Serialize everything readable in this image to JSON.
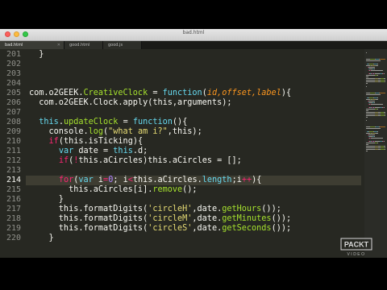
{
  "window": {
    "title": "bad.html"
  },
  "tabs": [
    {
      "label": "bad.html",
      "active": true
    },
    {
      "label": "good.html",
      "active": false
    },
    {
      "label": "good.js",
      "active": false
    }
  ],
  "editor": {
    "current_line": 214,
    "line_numbers": [
      201,
      202,
      203,
      204,
      205,
      206,
      207,
      208,
      209,
      210,
      211,
      212,
      213,
      214,
      215,
      216,
      217,
      218,
      219,
      220
    ],
    "lines": [
      [
        {
          "t": "  }",
          "c": "plain"
        }
      ],
      [],
      [],
      [],
      [
        {
          "t": "com.o2GEEK.",
          "c": "obj"
        },
        {
          "t": "CreativeClock",
          "c": "fn"
        },
        {
          "t": " = ",
          "c": "plain"
        },
        {
          "t": "function",
          "c": "kw"
        },
        {
          "t": "(",
          "c": "plain"
        },
        {
          "t": "id,offset,label",
          "c": "param"
        },
        {
          "t": "){",
          "c": "plain"
        }
      ],
      [
        {
          "t": "  com.o2GEEK.Clock.apply(this,arguments);",
          "c": "plain"
        }
      ],
      [],
      [
        {
          "t": "  ",
          "c": "plain"
        },
        {
          "t": "this",
          "c": "kw"
        },
        {
          "t": ".",
          "c": "plain"
        },
        {
          "t": "updateClock",
          "c": "fn"
        },
        {
          "t": " = ",
          "c": "plain"
        },
        {
          "t": "function",
          "c": "kw"
        },
        {
          "t": "(){",
          "c": "plain"
        }
      ],
      [
        {
          "t": "    console.",
          "c": "plain"
        },
        {
          "t": "log",
          "c": "fn"
        },
        {
          "t": "(",
          "c": "plain"
        },
        {
          "t": "\"what am i?\"",
          "c": "str"
        },
        {
          "t": ",this);",
          "c": "plain"
        }
      ],
      [
        {
          "t": "    ",
          "c": "plain"
        },
        {
          "t": "if",
          "c": "op"
        },
        {
          "t": "(this.isTicking){",
          "c": "plain"
        }
      ],
      [
        {
          "t": "      ",
          "c": "plain"
        },
        {
          "t": "var",
          "c": "kw"
        },
        {
          "t": " date = ",
          "c": "plain"
        },
        {
          "t": "this",
          "c": "kw"
        },
        {
          "t": ".d;",
          "c": "plain"
        }
      ],
      [
        {
          "t": "      ",
          "c": "plain"
        },
        {
          "t": "if",
          "c": "op"
        },
        {
          "t": "(",
          "c": "plain"
        },
        {
          "t": "!",
          "c": "op"
        },
        {
          "t": "this.aCircles)this.aCircles = [];",
          "c": "plain"
        }
      ],
      [],
      [
        {
          "t": "      ",
          "c": "plain"
        },
        {
          "t": "for",
          "c": "op"
        },
        {
          "t": "(",
          "c": "plain"
        },
        {
          "t": "var",
          "c": "kw"
        },
        {
          "t": " i",
          "c": "plain"
        },
        {
          "t": "=",
          "c": "op"
        },
        {
          "t": "0",
          "c": "num"
        },
        {
          "t": "; i",
          "c": "plain"
        },
        {
          "t": "<",
          "c": "op"
        },
        {
          "t": "this.aCircles.",
          "c": "plain"
        },
        {
          "t": "length",
          "c": "kw"
        },
        {
          "t": ";i",
          "c": "plain"
        },
        {
          "t": "++",
          "c": "op"
        },
        {
          "t": "){",
          "c": "plain"
        }
      ],
      [
        {
          "t": "        this.aCircles[i].",
          "c": "plain"
        },
        {
          "t": "remove",
          "c": "fn"
        },
        {
          "t": "();",
          "c": "plain"
        }
      ],
      [
        {
          "t": "      }",
          "c": "plain"
        }
      ],
      [
        {
          "t": "      this.formatDigits(",
          "c": "plain"
        },
        {
          "t": "'circleH'",
          "c": "str"
        },
        {
          "t": ",date.",
          "c": "plain"
        },
        {
          "t": "getHours",
          "c": "fn"
        },
        {
          "t": "());",
          "c": "plain"
        }
      ],
      [
        {
          "t": "      this.formatDigits(",
          "c": "plain"
        },
        {
          "t": "'circleM'",
          "c": "str"
        },
        {
          "t": ",date.",
          "c": "plain"
        },
        {
          "t": "getMinutes",
          "c": "fn"
        },
        {
          "t": "());",
          "c": "plain"
        }
      ],
      [
        {
          "t": "      this.formatDigits(",
          "c": "plain"
        },
        {
          "t": "'circleS'",
          "c": "str"
        },
        {
          "t": ",date.",
          "c": "plain"
        },
        {
          "t": "getSeconds",
          "c": "fn"
        },
        {
          "t": "());",
          "c": "plain"
        }
      ],
      [
        {
          "t": "    }",
          "c": "plain"
        }
      ]
    ]
  },
  "colors": {
    "plain": "#f8f8f2",
    "kw": "#66d9ef",
    "fn": "#a6e22e",
    "str": "#e6db74",
    "op": "#f92672",
    "param": "#fd971f",
    "num": "#ae81ff",
    "obj": "#f8f8f2"
  },
  "watermark": {
    "brand": "PACKT",
    "sub": "VIDEO"
  }
}
